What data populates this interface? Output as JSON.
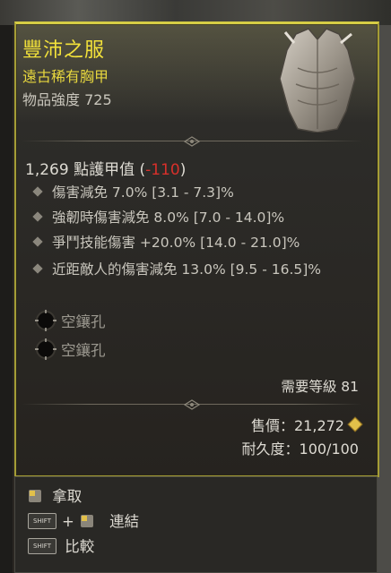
{
  "item": {
    "name": "豐沛之服",
    "rarity_type": "遠古稀有胸甲",
    "power": "物品強度 725",
    "armor_value": "1,269 點護甲值",
    "armor_delta_open": "(",
    "armor_delta": "-110",
    "armor_delta_close": ")",
    "affixes": [
      {
        "text": "傷害減免 7.0% [3.1 - 7.3]%"
      },
      {
        "text": "強韌時傷害減免 8.0% [7.0 - 14.0]%"
      },
      {
        "text": "爭鬥技能傷害 +20.0% [14.0 - 21.0]%"
      },
      {
        "text": "近距敵人的傷害減免 13.0% [9.5 - 16.5]%"
      }
    ],
    "sockets": [
      {
        "label": "空鑲孔"
      },
      {
        "label": "空鑲孔"
      }
    ],
    "required_level": "需要等級 81",
    "sell_value": "售價：21,272",
    "durability": "耐久度：100/100"
  },
  "actions": {
    "pickup": "拿取",
    "link_plus": "+",
    "link": "連結",
    "compare": "比較",
    "shift_key_text": "SHIFT"
  },
  "colors": {
    "legendary_border": "#d6cd45",
    "title_yellow": "#f3e23a",
    "negative_red": "#d8302b"
  }
}
